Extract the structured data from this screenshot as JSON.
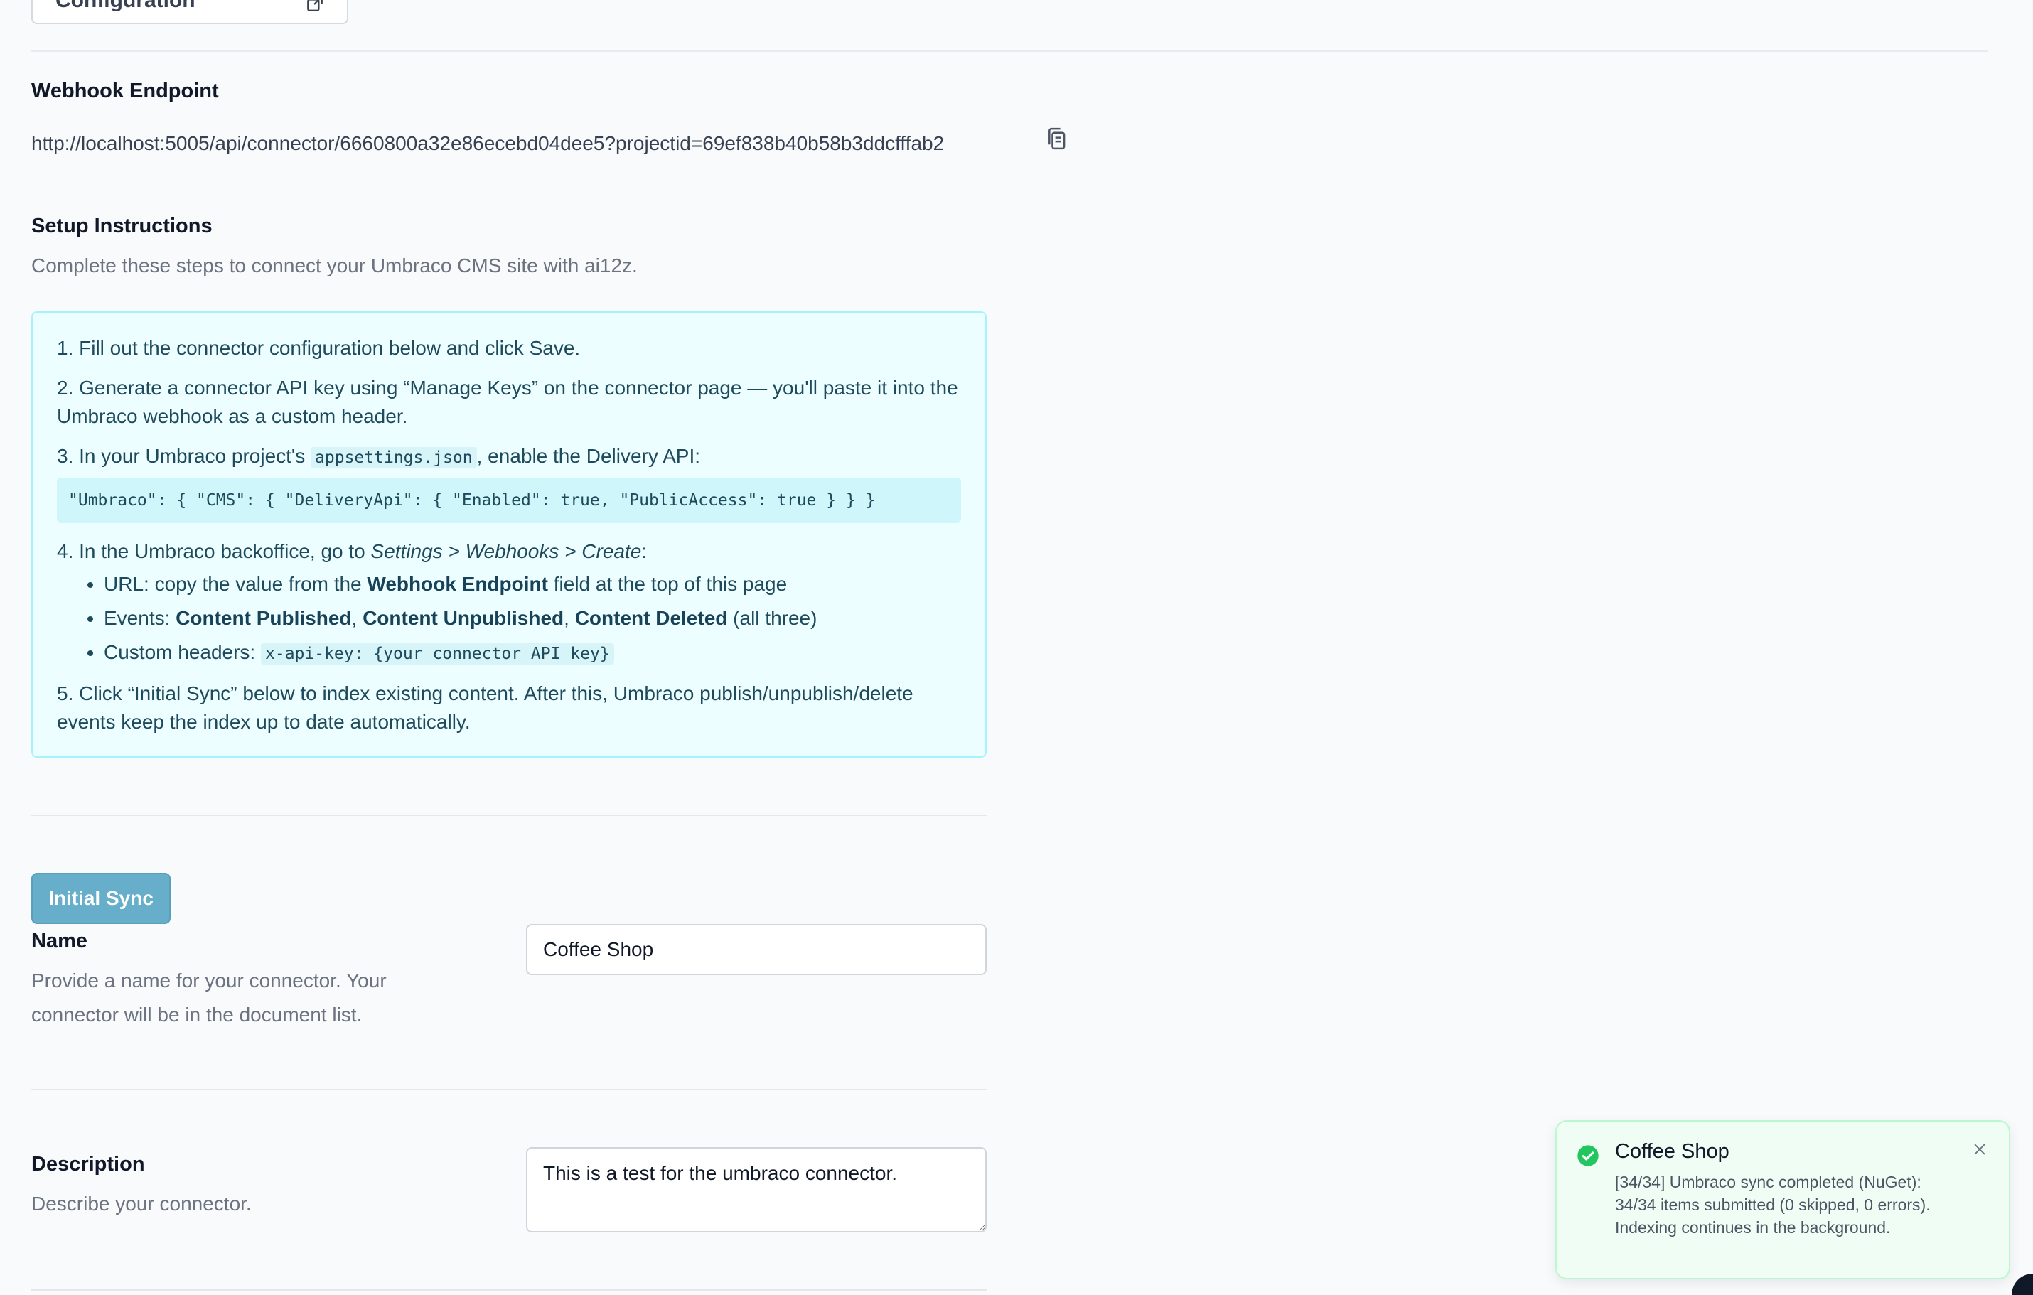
{
  "header": {
    "integration_button_label": "Integration Configuration"
  },
  "webhook": {
    "label": "Webhook Endpoint",
    "url": "http://localhost:5005/api/connector/6660800a32e86ecebd04dee5?projectid=69ef838b40b58b3ddcfffab2"
  },
  "setup": {
    "title": "Setup Instructions",
    "subtitle": "Complete these steps to connect your Umbraco CMS site with ai12z.",
    "step1": "1. Fill out the connector configuration below and click Save.",
    "step2": "2. Generate a connector API key using “Manage Keys” on the connector page — you'll paste it into the Umbraco webhook as a custom header.",
    "step3_prefix": "3. In your Umbraco project's ",
    "step3_code": "appsettings.json",
    "step3_suffix": ", enable the Delivery API:",
    "code_block": "\"Umbraco\": { \"CMS\": { \"DeliveryApi\": { \"Enabled\": true, \"PublicAccess\": true } } }",
    "step4_prefix": "4. In the Umbraco backoffice, go to ",
    "step4_path": "Settings > Webhooks > Create",
    "step4_suffix": ":",
    "bullet_url_prefix": "URL: copy the value from the ",
    "bullet_url_bold": "Webhook Endpoint",
    "bullet_url_suffix": " field at the top of this page",
    "bullet_events_prefix": "Events: ",
    "event1": "Content Published",
    "event2": "Content Unpublished",
    "event3": "Content Deleted",
    "comma": ", ",
    "bullet_events_suffix": " (all three)",
    "bullet_headers_prefix": "Custom headers: ",
    "bullet_headers_code": "x-api-key: {your connector API key}",
    "step5": "5. Click “Initial Sync” below to index existing content. After this, Umbraco publish/unpublish/delete events keep the index up to date automatically."
  },
  "sync": {
    "button_label": "Initial Sync"
  },
  "name_field": {
    "label": "Name",
    "help": "Provide a name for your connector. Your connector will be in the document list.",
    "value": "Coffee Shop"
  },
  "description_field": {
    "label": "Description",
    "help": "Describe your connector.",
    "value": "This is a test for the umbraco connector."
  },
  "toast": {
    "title": "Coffee Shop",
    "message": "[34/34] Umbraco sync completed (NuGet): 34/34 items submitted (0 skipped, 0 errors). Indexing continues in the background."
  },
  "colors": {
    "accent_button": "#67aecb",
    "info_panel_bg": "#ecfeff",
    "info_panel_border": "#a5f3fc",
    "success": "#22c55e"
  },
  "icons": {
    "copy": "copy-icon",
    "external_link": "external-link-icon",
    "success": "check-circle-icon",
    "close": "close-icon"
  }
}
